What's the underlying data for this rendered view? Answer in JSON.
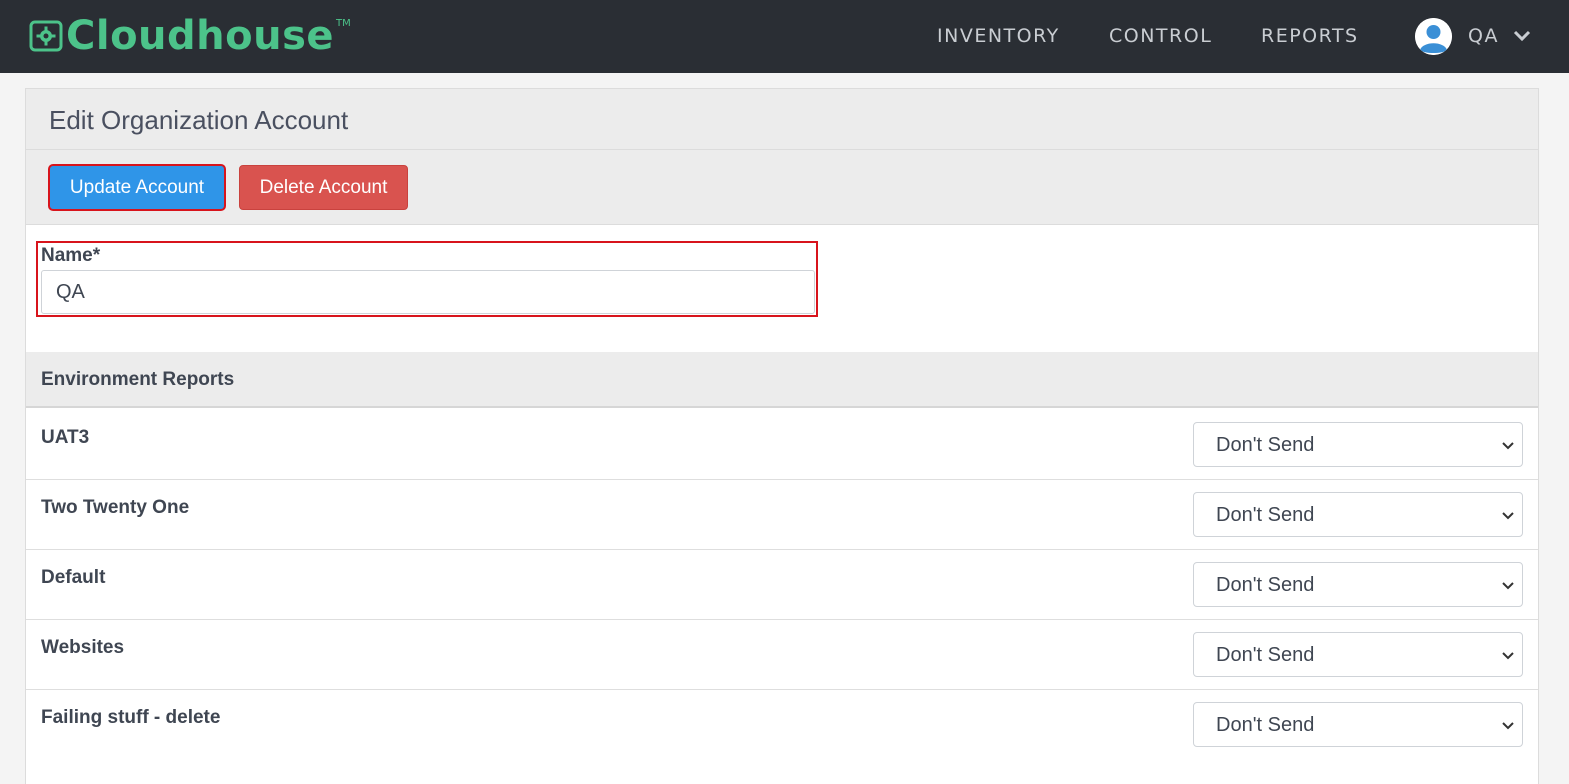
{
  "navbar": {
    "brand": "Cloudhouse",
    "trademark": "TM",
    "links": [
      "INVENTORY",
      "CONTROL",
      "REPORTS"
    ],
    "user": "QA",
    "colors": {
      "background": "#2a2e34",
      "brand": "#4cc38a"
    }
  },
  "page": {
    "title": "Edit Organization Account",
    "update_label": "Update Account",
    "delete_label": "Delete Account",
    "name_label": "Name*",
    "name_value": "QA"
  },
  "reports": {
    "section_title": "Environment Reports",
    "rows": [
      {
        "name": "UAT3",
        "value": "Don't Send"
      },
      {
        "name": "Two Twenty One",
        "value": "Don't Send"
      },
      {
        "name": "Default",
        "value": "Don't Send"
      },
      {
        "name": "Websites",
        "value": "Don't Send"
      },
      {
        "name": "Failing stuff - delete",
        "value": "Don't Send"
      }
    ]
  },
  "colors": {
    "primary": "#2f95e8",
    "danger": "#d9534f",
    "highlight": "#d8141c"
  }
}
